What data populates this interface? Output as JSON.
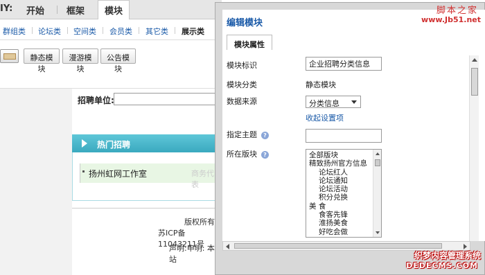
{
  "topnav": {
    "prefix": "IY:",
    "tabs": [
      "开始",
      "框架",
      "模块"
    ],
    "active_tab": "模块"
  },
  "catbar": {
    "items": [
      "群组类",
      "论坛类",
      "空间类",
      "会员类",
      "其它类",
      "展示类"
    ],
    "active": "展示类"
  },
  "toolbar": {
    "buttons": [
      "静态模块",
      "漫游模块",
      "公告模块"
    ]
  },
  "page": {
    "field_label": "招聘单位:",
    "hot_title": "热门招聘",
    "hot_item": "扬州虹网工作室",
    "hot_item_gray": "商务代表",
    "footer_lines": [
      "版权所有:",
      "苏ICP备11043211号",
      "声明:申明: 本站"
    ]
  },
  "modal": {
    "title": "编辑模块",
    "tab": "模块属性",
    "labels": {
      "identifier": "模块标识",
      "category": "模块分类",
      "source": "数据来源",
      "topic": "指定主题",
      "section": "所在版块"
    },
    "identifier_value": "企业招聘分类信息",
    "category_value": "静态模块",
    "source_selected": "分类信息",
    "settings_link": "收起设置项",
    "topic_value": "",
    "section_options": [
      {
        "label": "全部版块",
        "level": 0
      },
      {
        "label": "精致扬州官方信息",
        "level": 0
      },
      {
        "label": "论坛红人",
        "level": 1
      },
      {
        "label": "论坛通知",
        "level": 1
      },
      {
        "label": "论坛活动",
        "level": 1
      },
      {
        "label": "积分兑换",
        "level": 1
      },
      {
        "label": "美  食",
        "level": 0
      },
      {
        "label": "食客先锋",
        "level": 1
      },
      {
        "label": "淮扬美食",
        "level": 1
      },
      {
        "label": "好吃会做",
        "level": 1
      }
    ]
  },
  "watermark": {
    "top_cn": "脚本之家",
    "top_url": "www.Jb51.net",
    "bottom_cn": "织梦内容管理系统",
    "bottom_en": "DEDECMS.COM"
  },
  "colors": {
    "accent": "#1a5aa8",
    "hot_header": "#3aa9bf",
    "watermark_red": "#d03030"
  }
}
